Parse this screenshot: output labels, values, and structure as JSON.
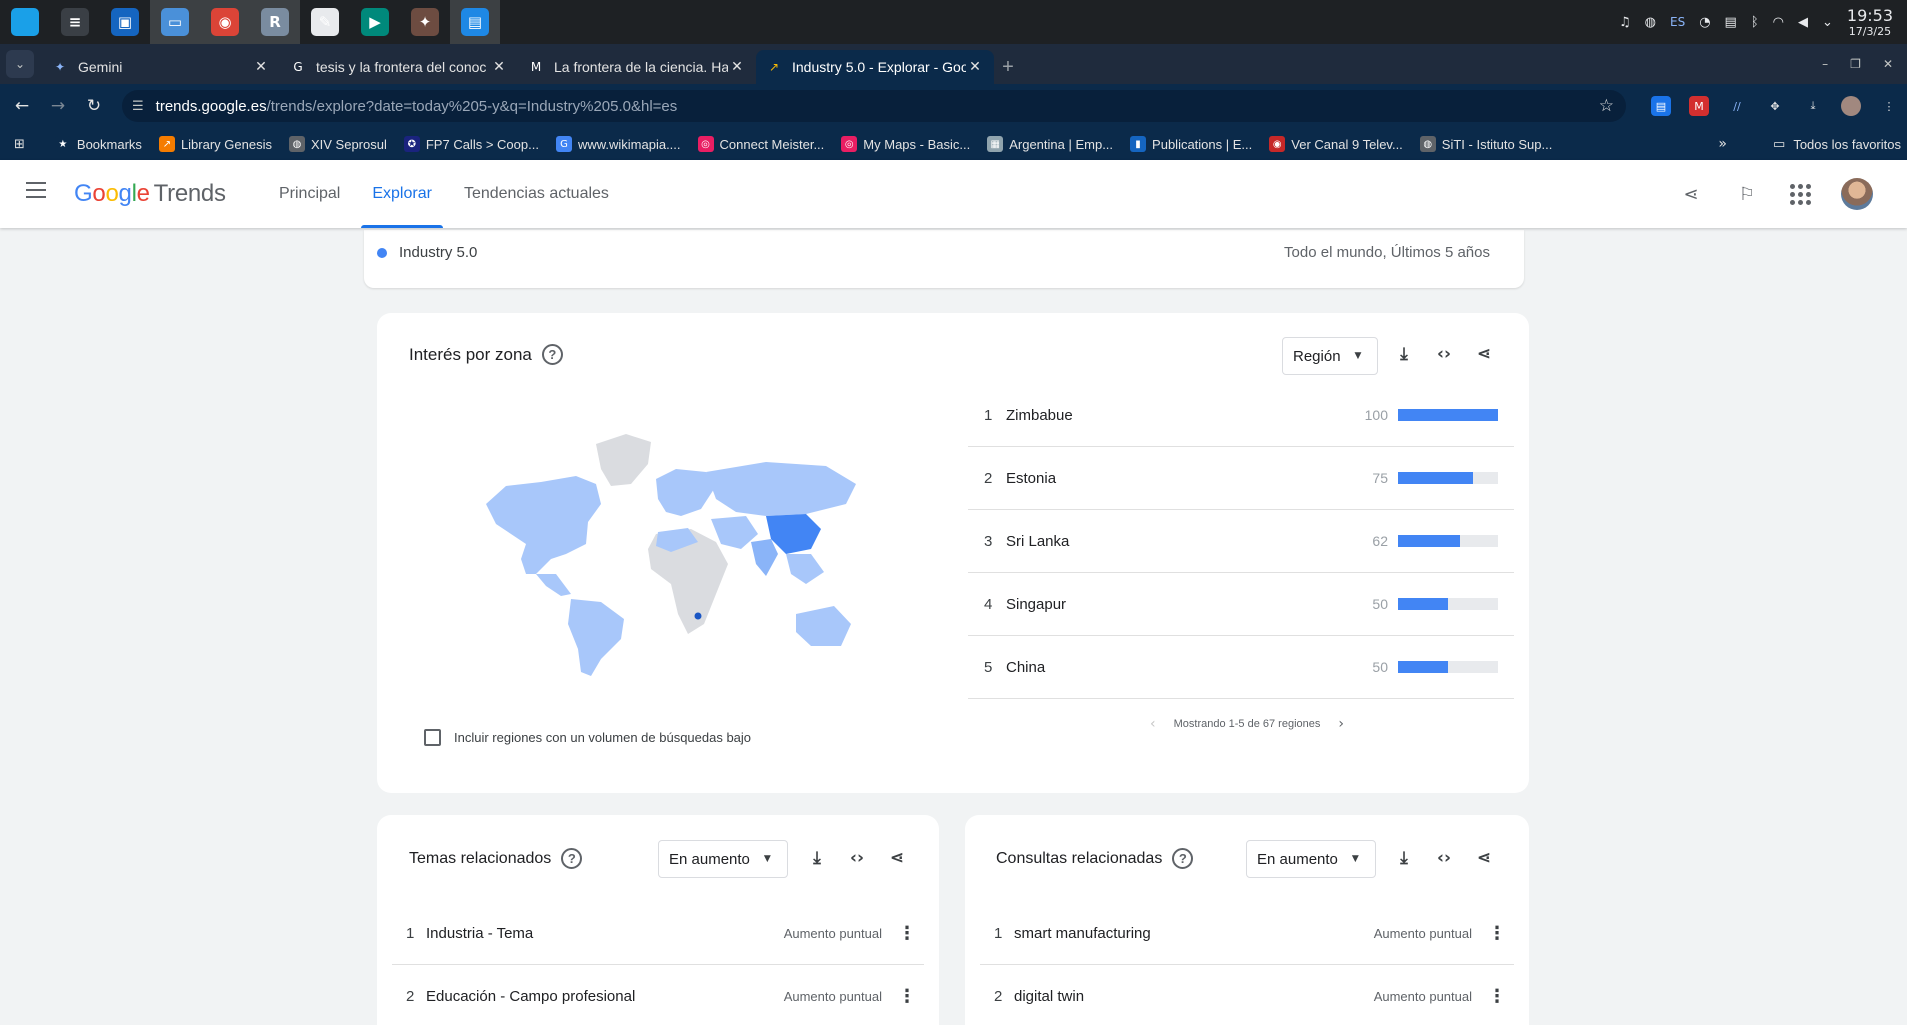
{
  "taskbar": {
    "apps": [
      {
        "name": "apple-icon",
        "glyph": "",
        "color": "#1aa0e8",
        "active": false
      },
      {
        "name": "panel-settings-icon",
        "glyph": "≡",
        "color": "#3a3f45",
        "active": false
      },
      {
        "name": "store-icon",
        "glyph": "▣",
        "color": "#1565c0",
        "active": false
      },
      {
        "name": "files-icon",
        "glyph": "▭",
        "color": "#4a90d9",
        "active": true
      },
      {
        "name": "chrome-icon",
        "glyph": "◉",
        "color": "#db4437",
        "active": true
      },
      {
        "name": "r-icon",
        "glyph": "R",
        "color": "#7a8ca0",
        "active": true
      },
      {
        "name": "editor-icon",
        "glyph": "✎",
        "color": "#e8eaed",
        "active": false
      },
      {
        "name": "meet-icon",
        "glyph": "▶",
        "color": "#00897b",
        "active": false
      },
      {
        "name": "gimp-icon",
        "glyph": "✦",
        "color": "#6d4c41",
        "active": false
      },
      {
        "name": "notes-icon",
        "glyph": "▤",
        "color": "#1e88e5",
        "active": true
      }
    ],
    "tray": {
      "lang": "ES",
      "time": "19:53",
      "date": "17/3/25"
    }
  },
  "tabs": [
    {
      "title": "Gemini",
      "fav": "✦",
      "favColor": "#8ab4f8",
      "active": false
    },
    {
      "title": "tesis y la frontera del conoc",
      "fav": "G",
      "favColor": "#ffffff",
      "active": false
    },
    {
      "title": "La frontera de la ciencia. Ha",
      "fav": "M",
      "favColor": "#ffffff",
      "active": false
    },
    {
      "title": "Industry 5.0 - Explorar - Goo",
      "fav": "↗",
      "favColor": "#fbbc04",
      "active": true
    }
  ],
  "omnibox": {
    "host": "trends.google.es",
    "path": "/trends/explore?date=today%205-y&q=Industry%205.0&hl=es"
  },
  "bookmarks": [
    {
      "label": "Bookmarks",
      "icon": "★",
      "color": "#0b2a4a"
    },
    {
      "label": "Library Genesis",
      "icon": "↗",
      "color": "#f57c00"
    },
    {
      "label": "XIV Seprosul",
      "icon": "◍",
      "color": "#5f6368"
    },
    {
      "label": "FP7 Calls > Coop...",
      "icon": "✪",
      "color": "#1a237e"
    },
    {
      "label": "www.wikimapia....",
      "icon": "G",
      "color": "#4285f4"
    },
    {
      "label": "Connect Meister...",
      "icon": "◎",
      "color": "#e91e63"
    },
    {
      "label": "My Maps - Basic...",
      "icon": "◎",
      "color": "#e91e63"
    },
    {
      "label": "Argentina | Emp...",
      "icon": "▦",
      "color": "#90a4ae"
    },
    {
      "label": "Publications | E...",
      "icon": "▮",
      "color": "#1565c0"
    },
    {
      "label": "Ver Canal 9 Telev...",
      "icon": "◉",
      "color": "#c62828"
    },
    {
      "label": "SiTI - Istituto Sup...",
      "icon": "◍",
      "color": "#5f6368"
    }
  ],
  "bookmarks_all": "Todos los favoritos",
  "header": {
    "logo_google": "Google",
    "logo_trends": "Trends",
    "nav": [
      {
        "label": "Principal",
        "active": false
      },
      {
        "label": "Explorar",
        "active": true
      },
      {
        "label": "Tendencias actuales",
        "active": false
      }
    ]
  },
  "comparison": {
    "term": "Industry 5.0",
    "scope": "Todo el mundo, Últimos 5 años"
  },
  "interest_by_region": {
    "title": "Interés por zona",
    "dropdown": "Región",
    "rows": [
      {
        "rank": "1",
        "name": "Zimbabue",
        "value": 100
      },
      {
        "rank": "2",
        "name": "Estonia",
        "value": 75
      },
      {
        "rank": "3",
        "name": "Sri Lanka",
        "value": 62
      },
      {
        "rank": "4",
        "name": "Singapur",
        "value": 50
      },
      {
        "rank": "5",
        "name": "China",
        "value": 50
      }
    ],
    "pager": "Mostrando 1-5 de 67 regiones",
    "checkbox": "Incluir regiones con un volumen de búsquedas bajo"
  },
  "related_topics": {
    "title": "Temas relacionados",
    "dropdown": "En aumento",
    "rows": [
      {
        "rank": "1",
        "name": "Industria - Tema",
        "badge": "Aumento puntual"
      },
      {
        "rank": "2",
        "name": "Educación - Campo profesional",
        "badge": "Aumento puntual"
      }
    ]
  },
  "related_queries": {
    "title": "Consultas relacionadas",
    "dropdown": "En aumento",
    "rows": [
      {
        "rank": "1",
        "name": "smart manufacturing",
        "badge": "Aumento puntual"
      },
      {
        "rank": "2",
        "name": "digital twin",
        "badge": "Aumento puntual"
      }
    ]
  },
  "colors": {
    "accent": "#1a73e8",
    "bar": "#4285f4",
    "mapLight": "#a8c7fa",
    "mapMid": "#8ab4f8",
    "mapStrong": "#4285f4",
    "mapNone": "#dadce0"
  }
}
